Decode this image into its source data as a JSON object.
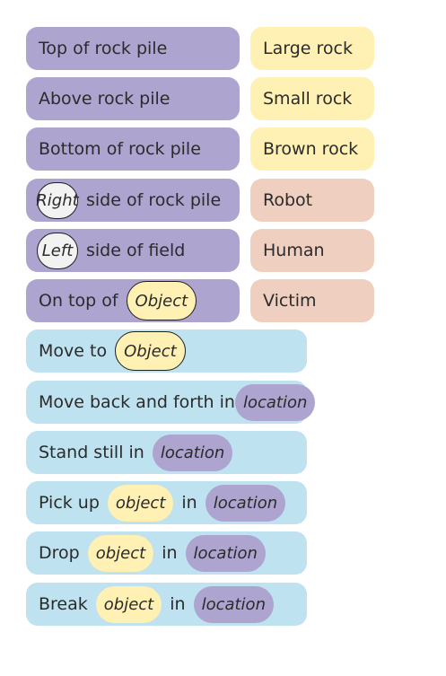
{
  "location_blocks": {
    "top_of_rock_pile": "Top of rock pile",
    "above_rock_pile": "Above rock pile",
    "bottom_of_rock_pile": "Bottom of rock pile",
    "side_of_rock_pile": {
      "slot": "Right",
      "text": "side of rock pile"
    },
    "side_of_field": {
      "slot": "Left",
      "text": "side of field"
    },
    "on_top_of": {
      "text": "On top of",
      "slot": "Object"
    }
  },
  "object_blocks": [
    "Large rock",
    "Small rock",
    "Brown rock"
  ],
  "entity_blocks": [
    "Robot",
    "Human",
    "Victim"
  ],
  "action_blocks": {
    "move_to": {
      "text": "Move to",
      "slot": "Object"
    },
    "move_back_forth": {
      "text": "Move back and forth in",
      "slot": "location"
    },
    "stand_still": {
      "text": "Stand still in",
      "slot": "location"
    },
    "pick_up": {
      "verb": "Pick up",
      "object": "object",
      "in": "in",
      "location": "location"
    },
    "drop": {
      "verb": "Drop",
      "object": "object",
      "in": "in",
      "location": "location"
    },
    "break": {
      "verb": "Break",
      "object": "object",
      "in": "in",
      "location": "location"
    }
  },
  "colors": {
    "location": "#ada4d0",
    "object": "#fff0b3",
    "entity": "#efcfc0",
    "action": "#bee2ef"
  }
}
